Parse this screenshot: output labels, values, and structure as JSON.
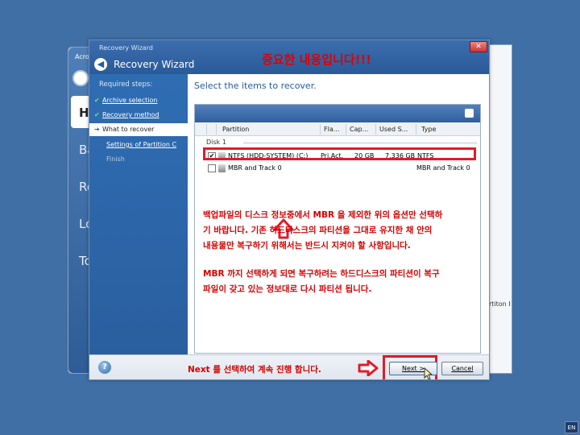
{
  "background": {
    "app_title": "Acro",
    "nav_items": [
      "Ho",
      "Ba",
      "Re",
      "Lo",
      "To"
    ],
    "right_text": "rtiton I"
  },
  "window": {
    "caption": "Recovery Wizard",
    "title": "Recovery Wizard",
    "close_label": "✕",
    "warning_title": "중요한 내용입니다!!!"
  },
  "sidebar": {
    "heading": "Required steps:",
    "steps": [
      {
        "label": "Archive selection",
        "mark": "✔"
      },
      {
        "label": "Recovery method",
        "mark": "✔"
      },
      {
        "label": "What to recover",
        "mark": "➔"
      },
      {
        "label": "Settings of Partition C",
        "mark": ""
      },
      {
        "label": "Finish",
        "mark": ""
      }
    ]
  },
  "content": {
    "title": "Select the items to recover.",
    "columns": [
      "Partition",
      "Fla...",
      "Cap...",
      "Used S...",
      "Type"
    ],
    "disk_label": "Disk 1",
    "rows": [
      {
        "checked": "✔",
        "partition": "NTFS (HDD-SYSTEM) (C:)",
        "flags": "Pri,Act.",
        "capacity": "20 GB",
        "used": "7.336 GB",
        "type": "NTFS"
      },
      {
        "checked": "",
        "partition": "MBR and Track 0",
        "flags": "",
        "capacity": "",
        "used": "",
        "type": "MBR and Track 0"
      }
    ],
    "note_lines_1": [
      "백업파일의 디스크 정보중에서 MBR 을 제외한 위의 옵션만 선택하",
      "기 바랍니다. 기존 하드디스크의 파티션을 그대로 유지한 채 안의",
      "내용물만 복구하기 위해서는 반드시 지켜야 할 사항입니다."
    ],
    "note_lines_2": [
      "MBR 까지 선택하게 되면 복구하려는 하드디스크의 파티션이 복구",
      "파일이 갖고 있는 정보대로 다시 파티션 됩니다."
    ]
  },
  "footer": {
    "help": "?",
    "note": "Next 를 선택하여 계속 진행 합니다.",
    "next_label": "Next >",
    "cancel_label": "Cancel"
  },
  "taskbar": {
    "lang": "EN"
  },
  "colors": {
    "highlight_red": "#e11b2b",
    "note_red": "#d60000",
    "accent_blue": "#2a5a98"
  }
}
